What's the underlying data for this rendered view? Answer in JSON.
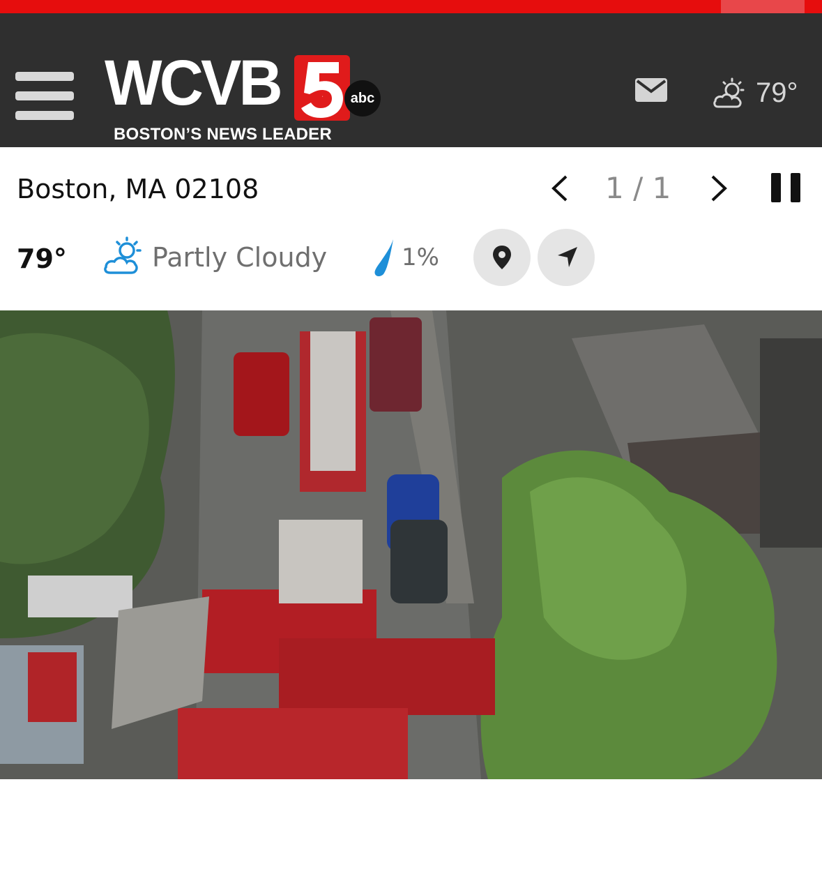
{
  "header": {
    "brand": "WCVB",
    "brand_number": "5",
    "network": "abc",
    "tagline": "BOSTON’S NEWS LEADER",
    "weather_icon": "partly-cloudy-icon",
    "temperature": "79°"
  },
  "location": {
    "name": "Boston, MA 02108",
    "counter": "1 / 1"
  },
  "weather": {
    "temperature": "79°",
    "condition": "Partly Cloudy",
    "precipitation": "1%",
    "icons": [
      "partly-cloudy-icon",
      "raindrop-icon",
      "location-pin-icon",
      "navigation-arrow-icon"
    ]
  },
  "colors": {
    "top_bar": "#e60d0d",
    "header_bg": "#2f2f2f",
    "brand_red": "#e01b1b",
    "accent_blue": "#1e8fd8"
  },
  "media": {
    "description_icon": "aerial-news-photo"
  }
}
